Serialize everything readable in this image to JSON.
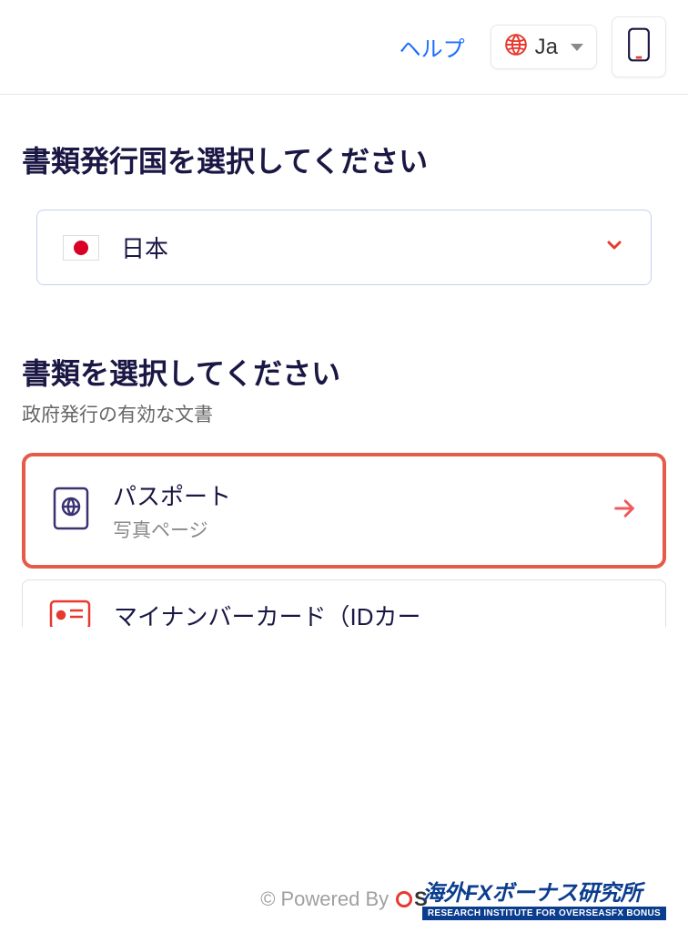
{
  "header": {
    "help_label": "ヘルプ",
    "language_label": "Ja"
  },
  "country_section": {
    "title": "書類発行国を選択してください",
    "selected_country": "日本"
  },
  "document_section": {
    "title": "書類を選択してください",
    "subtitle": "政府発行の有効な文書",
    "options": [
      {
        "title": "パスポート",
        "subtitle": "写真ページ"
      },
      {
        "title": "マイナンバーカード（IDカー"
      }
    ]
  },
  "footer": {
    "powered_by": "© Powered By"
  },
  "watermark": {
    "title": "海外FXボーナス研究所",
    "subtitle": "RESEARCH INSTITUTE FOR OVERSEASFX BONUS"
  }
}
